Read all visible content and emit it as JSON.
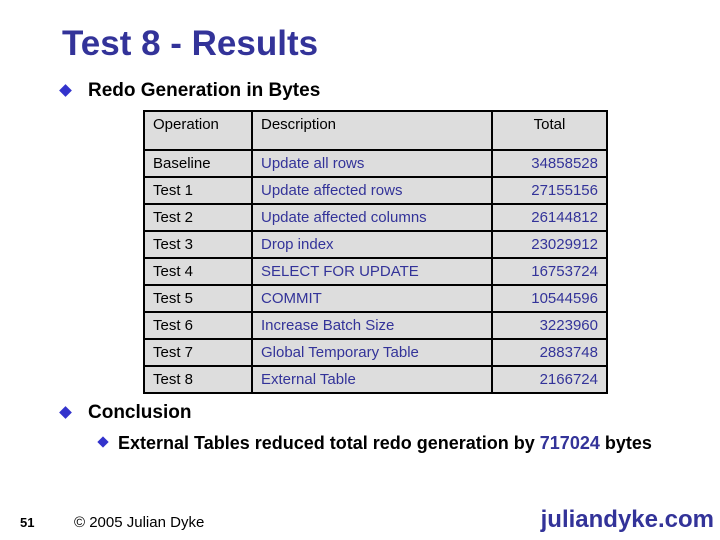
{
  "slide": {
    "title": "Test 8 - Results",
    "bullet1": "Redo Generation in Bytes",
    "table": {
      "headers": [
        "Operation",
        "Description",
        "Total"
      ],
      "rows": [
        {
          "operation": "Baseline",
          "description": "Update all rows",
          "total": "34858528"
        },
        {
          "operation": "Test 1",
          "description": "Update affected rows",
          "total": "27155156"
        },
        {
          "operation": "Test 2",
          "description": "Update affected columns",
          "total": "26144812"
        },
        {
          "operation": "Test 3",
          "description": "Drop index",
          "total": "23029912"
        },
        {
          "operation": "Test 4",
          "description": "SELECT FOR UPDATE",
          "total": "16753724"
        },
        {
          "operation": "Test 5",
          "description": "COMMIT",
          "total": "10544596"
        },
        {
          "operation": "Test 6",
          "description": "Increase Batch Size",
          "total": "3223960"
        },
        {
          "operation": "Test 7",
          "description": "Global Temporary Table",
          "total": "2883748"
        },
        {
          "operation": "Test 8",
          "description": "External Table",
          "total": "2166724"
        }
      ]
    },
    "bullet2": "Conclusion",
    "sub_bullet": {
      "prefix": "External Tables reduced total redo generation by ",
      "value": "717024",
      "suffix": " bytes"
    },
    "footer": {
      "page_number": "51",
      "copyright": "© 2005 Julian Dyke",
      "site": "juliandyke.com"
    },
    "colors": {
      "accent": "#333399",
      "bullet": "#3333cc",
      "table_bg": "#dddddd"
    }
  }
}
